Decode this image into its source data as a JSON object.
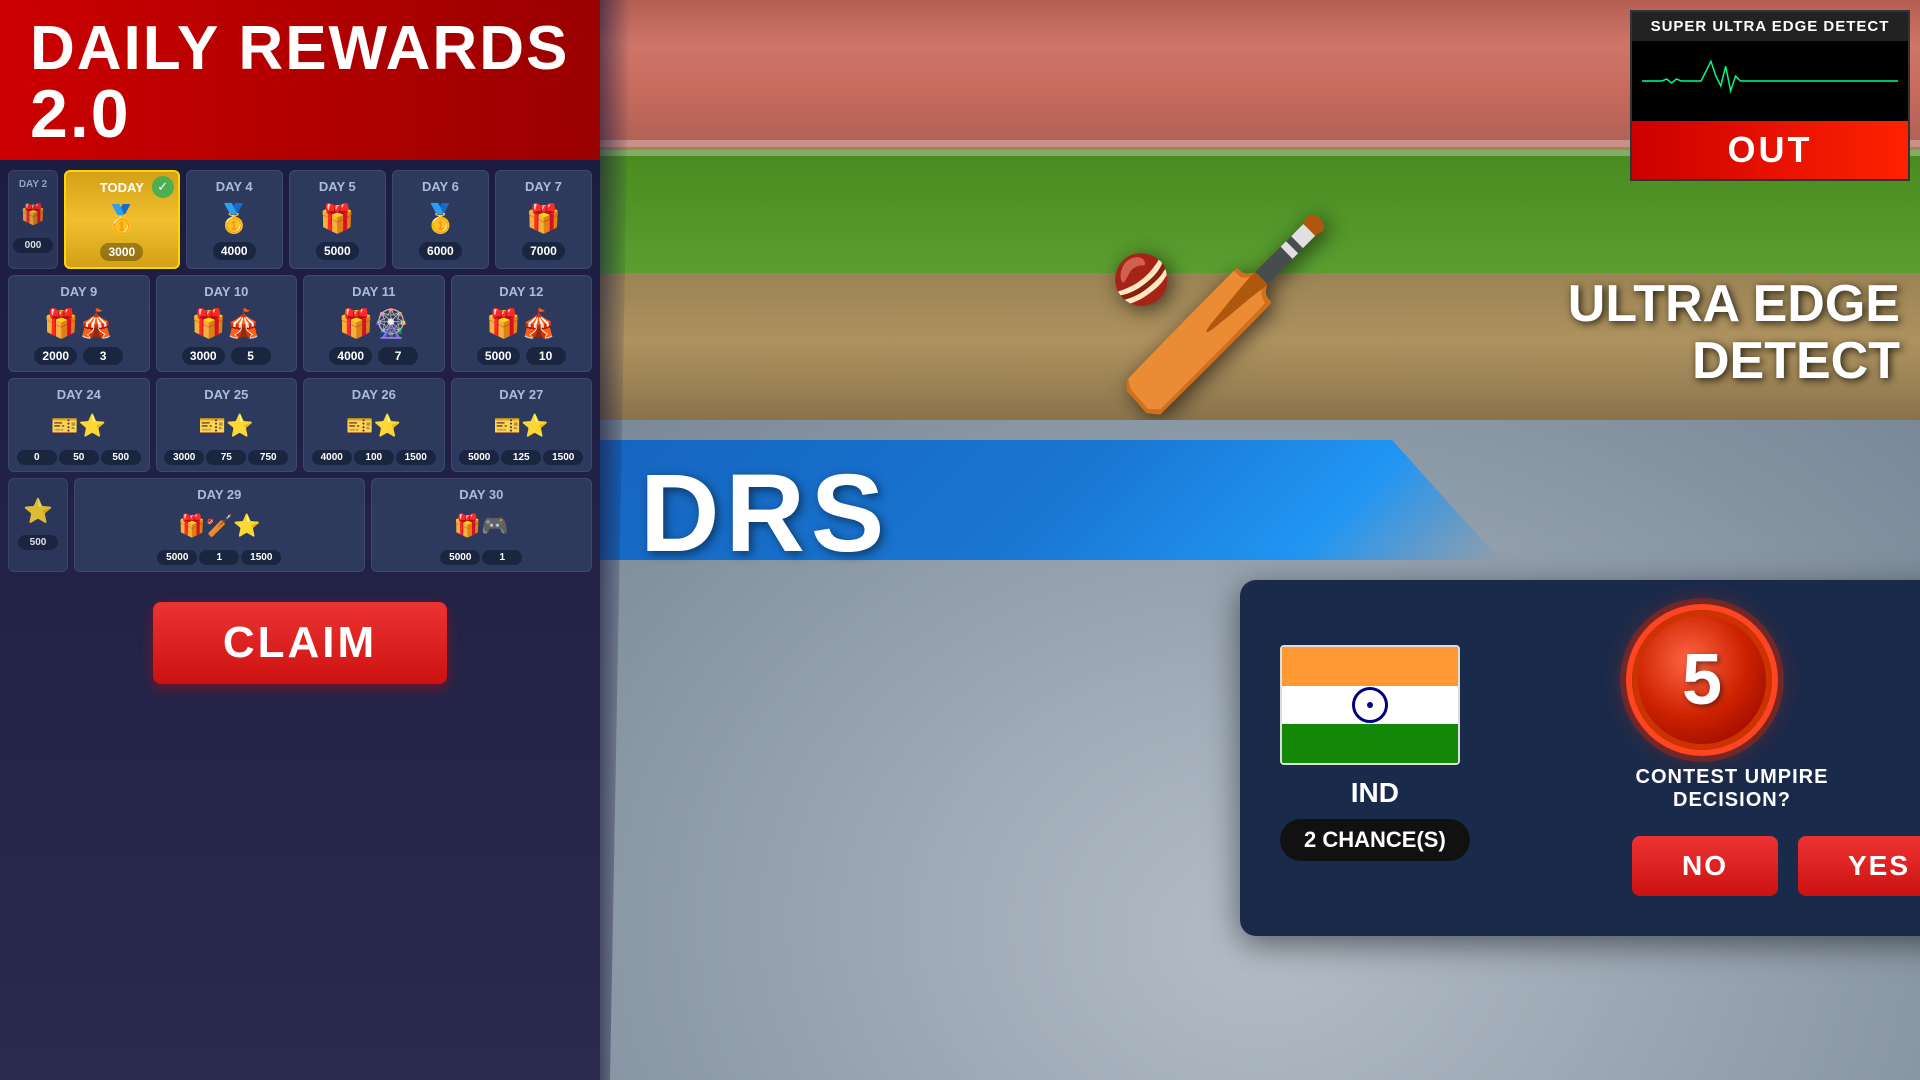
{
  "header": {
    "title": "DAILY REWARDS",
    "version": "2.0"
  },
  "days": [
    {
      "rows": [
        {
          "cards": [
            {
              "label": "DAY 2",
              "partial": true,
              "icons": [
                "🎁"
              ],
              "values": [
                "000"
              ],
              "checked": false
            },
            {
              "label": "TODAY",
              "today": true,
              "icons": [
                "🥇"
              ],
              "values": [
                "3000"
              ],
              "checked": true
            },
            {
              "label": "DAY 4",
              "icons": [
                "🥇"
              ],
              "values": [
                "4000"
              ],
              "checked": false
            },
            {
              "label": "DAY 5",
              "icons": [
                "🎁"
              ],
              "values": [
                "5000"
              ],
              "checked": false
            },
            {
              "label": "DAY 6",
              "icons": [
                "🥇"
              ],
              "values": [
                "6000"
              ],
              "checked": false
            },
            {
              "label": "DAY 7",
              "icons": [
                "🎁"
              ],
              "values": [
                "7000"
              ],
              "checked": false
            }
          ]
        },
        {
          "cards": [
            {
              "label": "DAY 9",
              "icons": [
                "🎁",
                "🎪"
              ],
              "values": [
                "2000",
                "3"
              ],
              "checked": false
            },
            {
              "label": "DAY 10",
              "icons": [
                "🎁",
                "🎪"
              ],
              "values": [
                "3000",
                "5"
              ],
              "checked": false
            },
            {
              "label": "DAY 11",
              "icons": [
                "🎁",
                "🎡"
              ],
              "values": [
                "4000",
                "7"
              ],
              "checked": false
            },
            {
              "label": "DAY 12",
              "icons": [
                "🎁",
                "🎪"
              ],
              "values": [
                "5000",
                "10"
              ],
              "checked": false
            }
          ]
        },
        {
          "cards": [
            {
              "label": "DAY 24",
              "icons": [
                "🎫",
                "⭐"
              ],
              "values": [
                "0",
                "50",
                "500"
              ],
              "checked": false
            },
            {
              "label": "DAY 25",
              "icons": [
                "🎫",
                "⭐"
              ],
              "values": [
                "3000",
                "75",
                "750"
              ],
              "checked": false
            },
            {
              "label": "DAY 26",
              "icons": [
                "🎫",
                "⭐"
              ],
              "values": [
                "4000",
                "100",
                "1500"
              ],
              "checked": false
            },
            {
              "label": "DAY 27",
              "icons": [
                "🎫",
                "⭐"
              ],
              "values": [
                "5000",
                "125",
                "1500"
              ],
              "checked": false
            }
          ]
        },
        {
          "cards": [
            {
              "label": "",
              "partial": true,
              "icons": [
                "⭐"
              ],
              "values": [
                "500"
              ],
              "checked": false
            },
            {
              "label": "DAY 29",
              "icons": [
                "🎁",
                "🏏",
                "⭐"
              ],
              "values": [
                "5000",
                "1",
                "1500"
              ],
              "checked": false
            },
            {
              "label": "DAY 30",
              "icons": [
                "🎁",
                "🎮"
              ],
              "values": [
                "5000",
                "1"
              ],
              "checked": false
            }
          ]
        }
      ]
    }
  ],
  "claim_button": "CLAIM",
  "ultra_edge": {
    "title": "SUPER ULTRA EDGE DETECT",
    "status": "OUT",
    "feature_name": "ULTRA EDGE\nDETECT"
  },
  "drs": {
    "label": "DRS",
    "country": "IND",
    "chances": "2 CHANCE(S)",
    "timer": "5",
    "contest_text": "CONTEST UMPIRE DECISION?",
    "no_button": "NO",
    "yes_button": "YES"
  }
}
